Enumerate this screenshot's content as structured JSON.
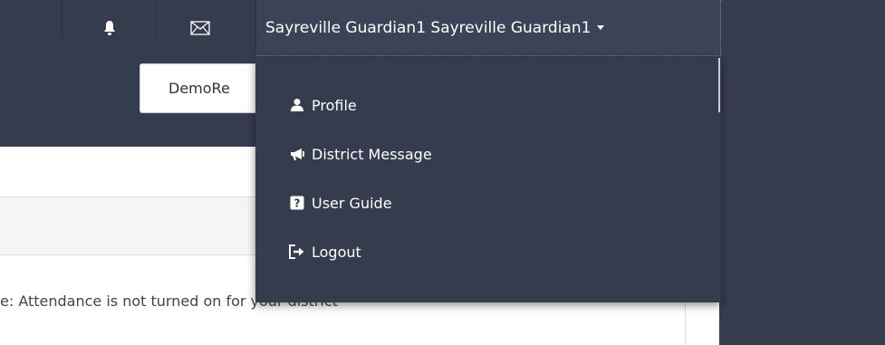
{
  "header": {
    "user_name": "Sayreville Guardian1 Sayreville Guardian1",
    "icons": [
      "bell-icon",
      "mail-icon",
      "caret-down-icon"
    ]
  },
  "toolbar": {
    "demo_button_label": "DemoRe"
  },
  "user_menu": {
    "items": [
      {
        "label": "Profile",
        "icon": "user-icon"
      },
      {
        "label": "District Message",
        "icon": "megaphone-icon"
      },
      {
        "label": "User Guide",
        "icon": "help-icon"
      },
      {
        "label": "Logout",
        "icon": "logout-icon"
      }
    ]
  },
  "main": {
    "notice_text": "e: Attendance is not turned on for your district"
  },
  "colors": {
    "topbar": "#353c4e",
    "menu_bg": "#353c4e",
    "text_light": "#ffffff"
  }
}
